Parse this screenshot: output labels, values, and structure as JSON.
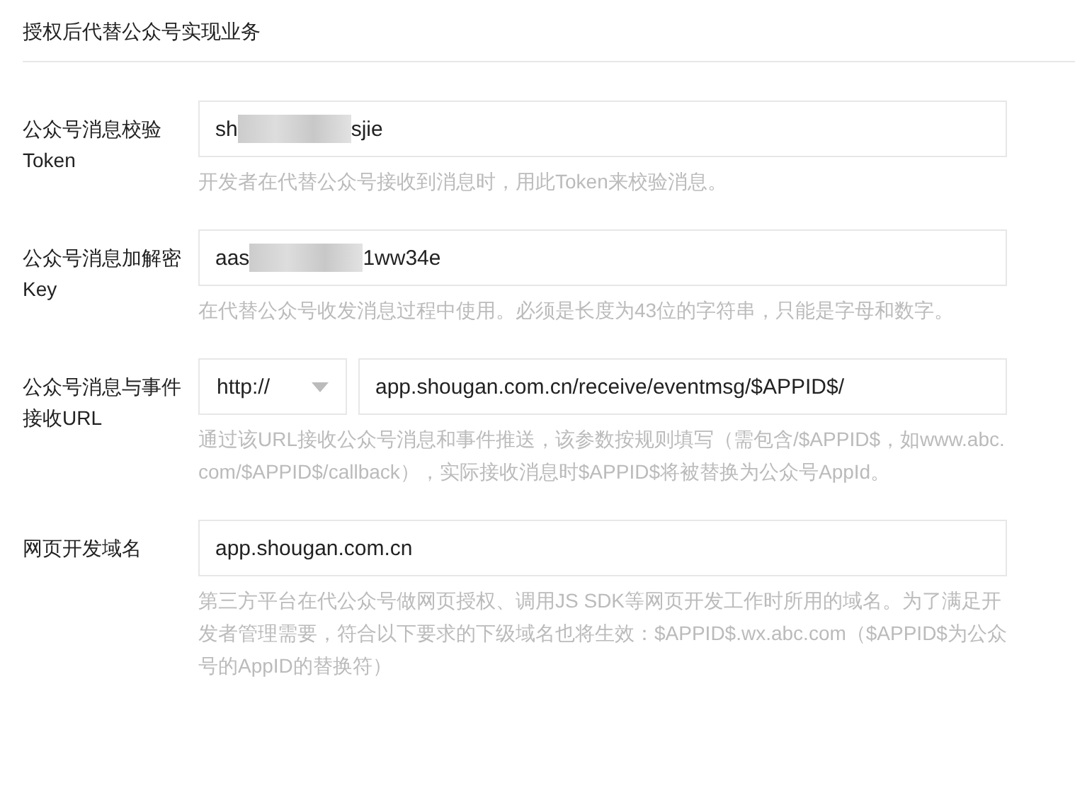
{
  "section_title": "授权后代替公众号实现业务",
  "fields": [
    {
      "kind": "text",
      "label": "公众号消息校验Token",
      "value_parts": [
        {
          "kind": "text",
          "text": "sh"
        },
        {
          "kind": "blur"
        },
        {
          "kind": "text",
          "text": "sjie"
        }
      ],
      "hint": "开发者在代替公众号接收到消息时，用此Token来校验消息。"
    },
    {
      "kind": "text",
      "label": "公众号消息加解密Key",
      "value_parts": [
        {
          "kind": "text",
          "text": "aas"
        },
        {
          "kind": "blur"
        },
        {
          "kind": "text",
          "text": "1ww34e"
        }
      ],
      "hint": "在代替公众号收发消息过程中使用。必须是长度为43位的字符串，只能是字母和数字。"
    },
    {
      "kind": "url",
      "label": "公众号消息与事件接收URL",
      "protocol": "http://",
      "value_parts": [
        {
          "kind": "text",
          "text": "app.shougan.com.cn/receive/eventmsg/$APPID$/"
        }
      ],
      "hint": "通过该URL接收公众号消息和事件推送，该参数按规则填写（需包含/$APPID$，如www.abc.com/$APPID$/callback），实际接收消息时$APPID$将被替换为公众号AppId。"
    },
    {
      "kind": "text",
      "label": "网页开发域名",
      "value_parts": [
        {
          "kind": "text",
          "text": "app.shougan.com.cn"
        }
      ],
      "hint": "第三方平台在代公众号做网页授权、调用JS SDK等网页开发工作时所用的域名。为了满足开发者管理需要，符合以下要求的下级域名也将生效：$APPID$.wx.abc.com（$APPID$为公众号的AppID的替换符）"
    }
  ]
}
